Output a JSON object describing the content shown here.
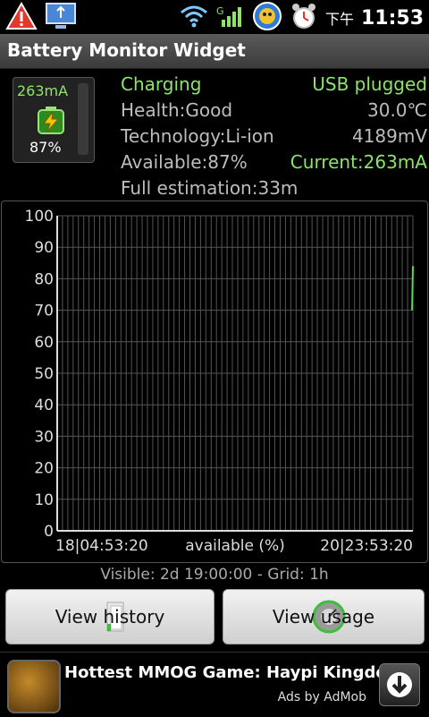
{
  "status_bar": {
    "ampm": "下午",
    "time": "11:53",
    "icons": [
      "warning-icon",
      "usb-debug-icon",
      "wifi-icon",
      "signal-icon",
      "sync-app-icon",
      "alarm-icon"
    ]
  },
  "app": {
    "title": "Battery Monitor Widget"
  },
  "battery_tile": {
    "current": "263mA",
    "percent": "87%"
  },
  "info": {
    "status": "Charging",
    "plug": "USB plugged",
    "health": "Health:Good",
    "temperature": "30.0℃",
    "technology": "Technology:Li-ion",
    "voltage": "4189mV",
    "available": "Available:87%",
    "current": "Current:263mA",
    "full_estimation": "Full estimation:33m"
  },
  "chart_data": {
    "type": "line",
    "xlabel": "available (%)",
    "x_start_label": "18|04:53:20",
    "x_end_label": "20|23:53:20",
    "ylim": [
      0,
      100
    ],
    "y_ticks": [
      0,
      10,
      20,
      30,
      40,
      50,
      60,
      70,
      80,
      90,
      100
    ],
    "x_range_hours": [
      0,
      67
    ],
    "series": [
      {
        "values": [
          {
            "x": 66.85,
            "y": 70
          },
          {
            "x": 67.0,
            "y": 84
          }
        ]
      }
    ],
    "grid": true,
    "colors": {
      "line": "#4de04d",
      "grid": "#555555",
      "axis": "#dddddd"
    }
  },
  "chart_footer": "Visible: 2d 19:00:00 - Grid: 1h",
  "buttons": {
    "history": "View history",
    "usage": "View usage"
  },
  "ad": {
    "title": "Hottest MMOG Game: Haypi Kingdom",
    "subtitle": "Ads by AdMob"
  }
}
